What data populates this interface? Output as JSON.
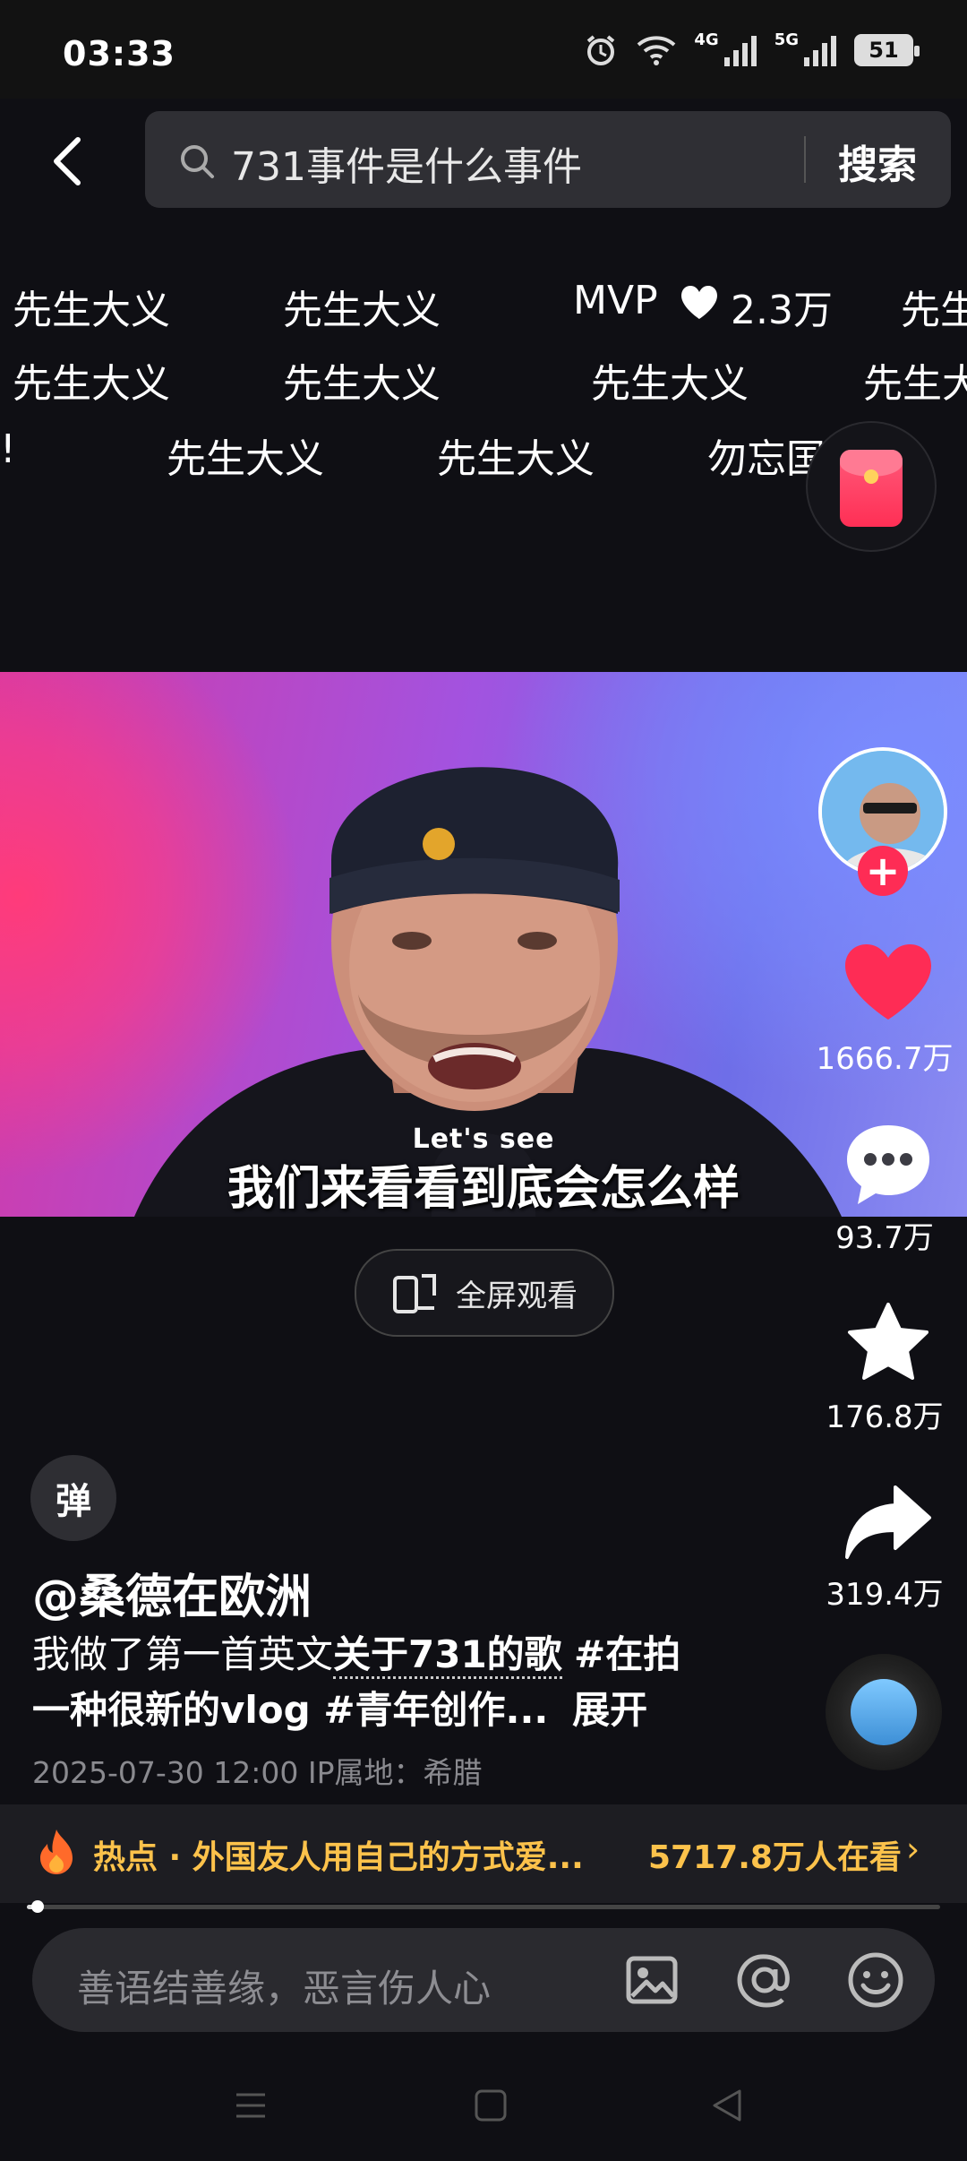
{
  "status_bar": {
    "time": "03:33",
    "network_4g": "4G",
    "network_5g": "5G",
    "battery": "51"
  },
  "search": {
    "query": "731事件是什么事件",
    "button_label": "搜索"
  },
  "danmaku": {
    "row1": [
      "先生大义",
      "先生大义",
      "MVP",
      "2.3万",
      "先生"
    ],
    "row2": [
      "先生大义",
      "先生大义",
      "先生大义",
      "先生大"
    ],
    "row3": [
      "!",
      "先生大义",
      "先生大义",
      "勿忘国耻"
    ]
  },
  "video": {
    "subtitle_en": "Let's see",
    "subtitle_zh": "我们来看看到底会怎么样"
  },
  "fullscreen_label": "全屏观看",
  "actions": {
    "likes": "1666.7万",
    "comments": "93.7万",
    "favorites": "176.8万",
    "shares": "319.4万"
  },
  "info": {
    "danmaku_toggle": "弹",
    "author": "@桑德在欧洲",
    "desc_part1": "我做了第一首英文",
    "desc_link": "关于731的歌",
    "desc_tag1": "#在拍",
    "desc_line2": "一种很新的vlog #青年创作...",
    "desc_expand": "展开",
    "timestamp": "2025-07-30 12:00  IP属地：希腊"
  },
  "hotbar": {
    "text": "热点 · 外国友人用自己的方式爱...",
    "count": "5717.8万人在看",
    "arrow": "›"
  },
  "progress": 0.012,
  "comment": {
    "placeholder": "善语结善缘，恶言伤人心"
  },
  "colors": {
    "like_red": "#fe2c55",
    "hot_yellow": "#fcc24b",
    "follow_pink": "#fe2c55"
  }
}
